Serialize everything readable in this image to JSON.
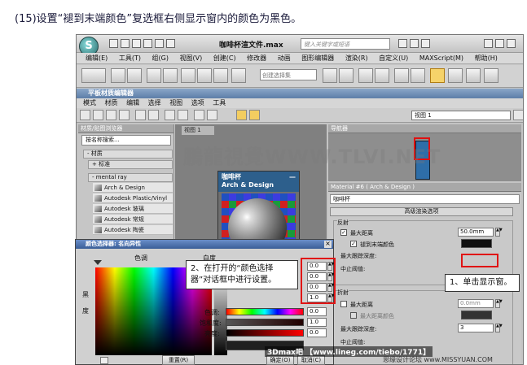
{
  "caption": "(15)设置“褪到末端颜色”复选框右侧显示窗内的颜色为黑色。",
  "app": {
    "logo": "S",
    "title": "咖啡杯渲文件.max",
    "search_placeholder": "键入关键字或短语",
    "menus": [
      "编辑(E)",
      "工具(T)",
      "组(G)",
      "视图(V)",
      "创建(C)",
      "修改器",
      "动画",
      "图形编辑器",
      "渲染(R)",
      "自定义(U)",
      "MAXScript(M)",
      "帮助(H)"
    ],
    "toolbar_select": "创建选择集"
  },
  "sme": {
    "title": "平板材质编辑器",
    "menus": [
      "模式",
      "材质",
      "编辑",
      "选择",
      "视图",
      "选项",
      "工具"
    ],
    "view_select": "视图 1",
    "browser": {
      "header": "材质/贴图浏览器",
      "search": "按名称搜索...",
      "group_material": "- 材质",
      "group_standard": "+ 标准",
      "group_mentalray": "- mental ray",
      "items": [
        "Arch & Design",
        "Autodesk Plastic/Vinyl",
        "Autodesk 玻璃",
        "Autodesk 常规",
        "Autodesk 陶瓷"
      ]
    },
    "view_tab": "视图 1",
    "node": {
      "name": "咖啡杯",
      "type": "Arch & Design",
      "collapse": "—"
    },
    "navigator_header": "导航器",
    "props": {
      "header": "Material #6 ( Arch & Design )",
      "name": "咖啡杯",
      "rollout": "高级渲染选项",
      "reflection_label": "反射",
      "max_distance_label": "最大距离",
      "max_distance_value": "50.0mm",
      "fade_label": "褪到末端颜色",
      "max_depth_label": "最大跟踪深度:",
      "cutoff_label": "中止阈值:",
      "refraction_label": "折射",
      "r_max_distance_label": "最大距离",
      "r_max_distance_value": "0.0mm",
      "r_fade_label": "最大距离颜色",
      "r_max_depth_label": "最大跟踪深度:",
      "r_max_depth_value": "3",
      "r_cutoff_label": "中止阈值:",
      "fade_color": "#101010"
    }
  },
  "color_picker": {
    "title": "颜色选择器: 名向异性",
    "hue_label": "色调",
    "white_label": "白度",
    "black_label": "黑",
    "degree_label": "度",
    "values": [
      "0.0",
      "0.0",
      "0.0",
      "1.0"
    ],
    "slider_labels": [
      "色调:",
      "饱和度:",
      "亮度:"
    ],
    "slider_values": [
      "0.0",
      "1.0",
      "0.0"
    ],
    "reset_label": "重置(R)",
    "ok_label": "确定(O)",
    "cancel_label": "取消(C)"
  },
  "annotations": {
    "step1": "1、单击显示窗。",
    "step2_line1": "2、在打开的“颜色选择",
    "step2_line2": "器”对话框中进行设置。"
  },
  "watermarks": {
    "main": "鵬龍視覺WWW.TLVI.NET",
    "bottom": "3Dmax吧 【www.lineg.com/tiebo/1771】",
    "bottom2": "思缘设计论坛 www.MISSYUAN.COM"
  }
}
